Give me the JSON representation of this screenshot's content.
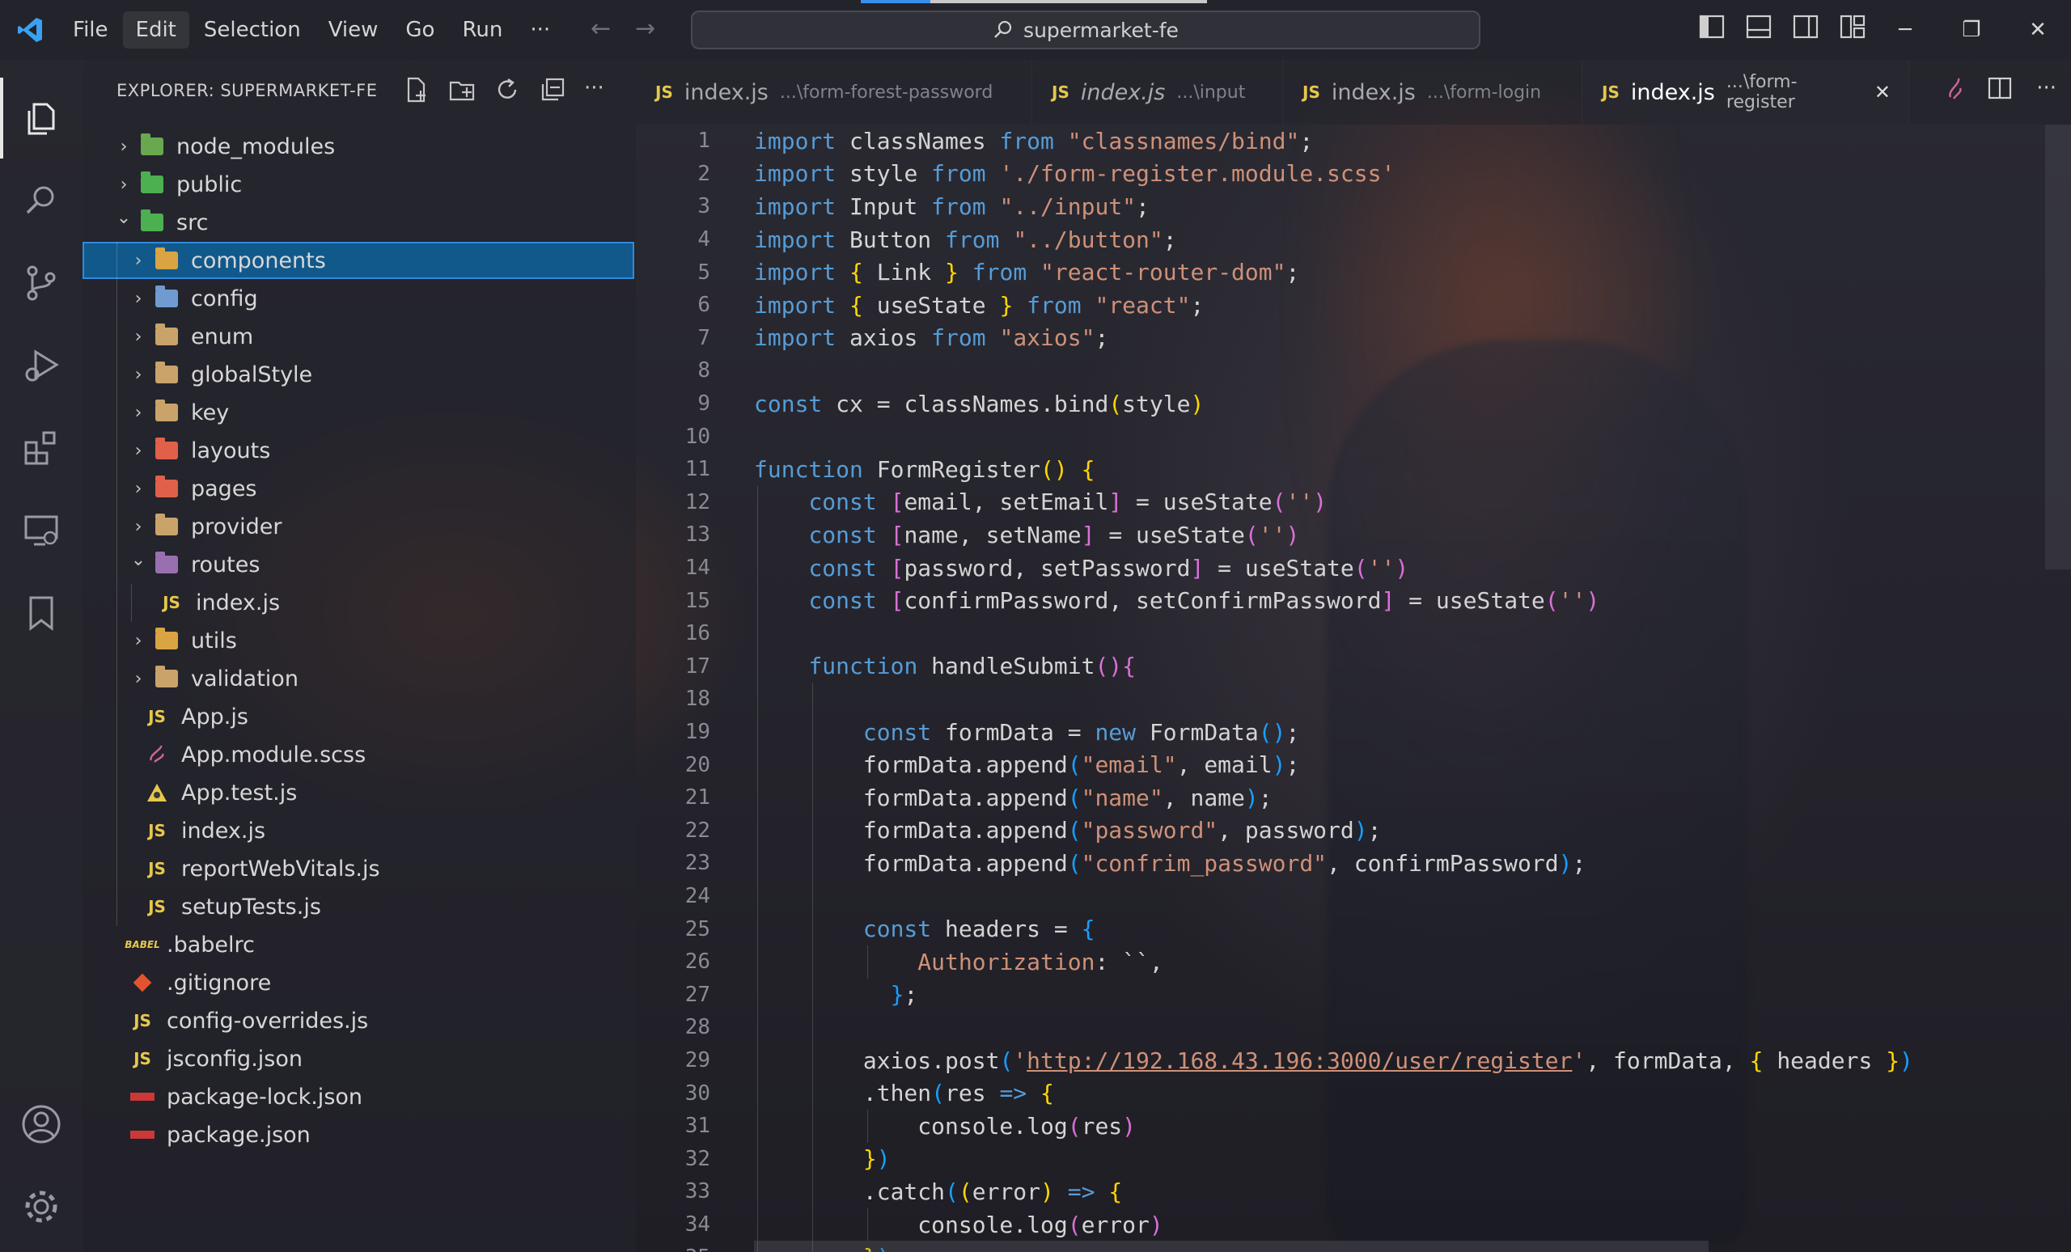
{
  "titlebar": {
    "menu": [
      "File",
      "Edit",
      "Selection",
      "View",
      "Go",
      "Run",
      "···"
    ],
    "search_text": "supermarket-fe"
  },
  "sidebar": {
    "title": "EXPLORER: SUPERMARKET-FE",
    "tree": [
      {
        "label": "node_modules",
        "type": "folder",
        "depth": 0,
        "expanded": false,
        "icon_color": "#6aa84f"
      },
      {
        "label": "public",
        "type": "folder",
        "depth": 0,
        "expanded": false,
        "icon_color": "#4caf50"
      },
      {
        "label": "src",
        "type": "folder",
        "depth": 0,
        "expanded": true,
        "icon_color": "#4caf50"
      },
      {
        "label": "components",
        "type": "folder",
        "depth": 1,
        "expanded": false,
        "icon_color": "#d9a441",
        "selected": true
      },
      {
        "label": "config",
        "type": "folder",
        "depth": 1,
        "expanded": false,
        "icon_color": "#6f9bd1"
      },
      {
        "label": "enum",
        "type": "folder",
        "depth": 1,
        "expanded": false,
        "icon_color": "#c9a36a"
      },
      {
        "label": "globalStyle",
        "type": "folder",
        "depth": 1,
        "expanded": false,
        "icon_color": "#c9a36a"
      },
      {
        "label": "key",
        "type": "folder",
        "depth": 1,
        "expanded": false,
        "icon_color": "#c9a36a"
      },
      {
        "label": "layouts",
        "type": "folder",
        "depth": 1,
        "expanded": false,
        "icon_color": "#e0604a"
      },
      {
        "label": "pages",
        "type": "folder",
        "depth": 1,
        "expanded": false,
        "icon_color": "#e0604a"
      },
      {
        "label": "provider",
        "type": "folder",
        "depth": 1,
        "expanded": false,
        "icon_color": "#c9a36a"
      },
      {
        "label": "routes",
        "type": "folder",
        "depth": 1,
        "expanded": true,
        "icon_color": "#9a6fb0"
      },
      {
        "label": "index.js",
        "type": "js",
        "depth": 2
      },
      {
        "label": "utils",
        "type": "folder",
        "depth": 1,
        "expanded": false,
        "icon_color": "#d9a441"
      },
      {
        "label": "validation",
        "type": "folder",
        "depth": 1,
        "expanded": false,
        "icon_color": "#c9a36a"
      },
      {
        "label": "App.js",
        "type": "js",
        "depth": 1
      },
      {
        "label": "App.module.scss",
        "type": "scss",
        "depth": 1
      },
      {
        "label": "App.test.js",
        "type": "test",
        "depth": 1
      },
      {
        "label": "index.js",
        "type": "js",
        "depth": 1
      },
      {
        "label": "reportWebVitals.js",
        "type": "js",
        "depth": 1
      },
      {
        "label": "setupTests.js",
        "type": "js",
        "depth": 1
      },
      {
        "label": ".babelrc",
        "type": "babel",
        "depth": 0
      },
      {
        "label": ".gitignore",
        "type": "git",
        "depth": 0
      },
      {
        "label": "config-overrides.js",
        "type": "js",
        "depth": 0
      },
      {
        "label": "jsconfig.json",
        "type": "jsconfig",
        "depth": 0
      },
      {
        "label": "package-lock.json",
        "type": "npm",
        "depth": 0
      },
      {
        "label": "package.json",
        "type": "npm",
        "depth": 0
      }
    ]
  },
  "tabs": [
    {
      "name": "index.js",
      "path": "...\\form-forest-password",
      "badge": "JS",
      "italic": false,
      "active": false
    },
    {
      "name": "index.js",
      "path": "...\\input",
      "badge": "JS",
      "italic": true,
      "active": false
    },
    {
      "name": "index.js",
      "path": "...\\form-login",
      "badge": "JS",
      "italic": false,
      "active": false
    },
    {
      "name": "index.js",
      "path": "...\\form-register",
      "badge": "JS",
      "italic": false,
      "active": true
    }
  ],
  "editor": {
    "lines": [
      [
        [
          "kw",
          "import"
        ],
        [
          "pl",
          " classNames "
        ],
        [
          "kw",
          "from"
        ],
        [
          "pl",
          " "
        ],
        [
          "str",
          "\"classnames/bind\""
        ],
        [
          "pl",
          ";"
        ]
      ],
      [
        [
          "kw",
          "import"
        ],
        [
          "pl",
          " style "
        ],
        [
          "kw",
          "from"
        ],
        [
          "pl",
          " "
        ],
        [
          "str",
          "'./form-register.module.scss'"
        ]
      ],
      [
        [
          "kw",
          "import"
        ],
        [
          "pl",
          " Input "
        ],
        [
          "kw",
          "from"
        ],
        [
          "pl",
          " "
        ],
        [
          "str",
          "\"../input\""
        ],
        [
          "pl",
          ";"
        ]
      ],
      [
        [
          "kw",
          "import"
        ],
        [
          "pl",
          " Button "
        ],
        [
          "kw",
          "from"
        ],
        [
          "pl",
          " "
        ],
        [
          "str",
          "\"../button\""
        ],
        [
          "pl",
          ";"
        ]
      ],
      [
        [
          "kw",
          "import"
        ],
        [
          "pl",
          " "
        ],
        [
          "b1",
          "{"
        ],
        [
          "pl",
          " Link "
        ],
        [
          "b1",
          "}"
        ],
        [
          "pl",
          " "
        ],
        [
          "kw",
          "from"
        ],
        [
          "pl",
          " "
        ],
        [
          "str",
          "\"react-router-dom\""
        ],
        [
          "pl",
          ";"
        ]
      ],
      [
        [
          "kw",
          "import"
        ],
        [
          "pl",
          " "
        ],
        [
          "b1",
          "{"
        ],
        [
          "pl",
          " useState "
        ],
        [
          "b1",
          "}"
        ],
        [
          "pl",
          " "
        ],
        [
          "kw",
          "from"
        ],
        [
          "pl",
          " "
        ],
        [
          "str",
          "\"react\""
        ],
        [
          "pl",
          ";"
        ]
      ],
      [
        [
          "kw",
          "import"
        ],
        [
          "pl",
          " axios "
        ],
        [
          "kw",
          "from"
        ],
        [
          "pl",
          " "
        ],
        [
          "str",
          "\"axios\""
        ],
        [
          "pl",
          ";"
        ]
      ],
      [],
      [
        [
          "kw",
          "const"
        ],
        [
          "pl",
          " cx = classNames.bind"
        ],
        [
          "b1",
          "("
        ],
        [
          "pl",
          "style"
        ],
        [
          "b1",
          ")"
        ]
      ],
      [],
      [
        [
          "kw",
          "function"
        ],
        [
          "pl",
          " FormRegister"
        ],
        [
          "b1",
          "()"
        ],
        [
          "pl",
          " "
        ],
        [
          "b1",
          "{"
        ]
      ],
      [
        [
          "pl",
          "    "
        ],
        [
          "kw",
          "const"
        ],
        [
          "pl",
          " "
        ],
        [
          "b2",
          "["
        ],
        [
          "pl",
          "email, setEmail"
        ],
        [
          "b2",
          "]"
        ],
        [
          "pl",
          " = useState"
        ],
        [
          "b2",
          "("
        ],
        [
          "str",
          "''"
        ],
        [
          "b2",
          ")"
        ]
      ],
      [
        [
          "pl",
          "    "
        ],
        [
          "kw",
          "const"
        ],
        [
          "pl",
          " "
        ],
        [
          "b2",
          "["
        ],
        [
          "pl",
          "name, setName"
        ],
        [
          "b2",
          "]"
        ],
        [
          "pl",
          " = useState"
        ],
        [
          "b2",
          "("
        ],
        [
          "str",
          "''"
        ],
        [
          "b2",
          ")"
        ]
      ],
      [
        [
          "pl",
          "    "
        ],
        [
          "kw",
          "const"
        ],
        [
          "pl",
          " "
        ],
        [
          "b2",
          "["
        ],
        [
          "pl",
          "password, setPassword"
        ],
        [
          "b2",
          "]"
        ],
        [
          "pl",
          " = useState"
        ],
        [
          "b2",
          "("
        ],
        [
          "str",
          "''"
        ],
        [
          "b2",
          ")"
        ]
      ],
      [
        [
          "pl",
          "    "
        ],
        [
          "kw",
          "const"
        ],
        [
          "pl",
          " "
        ],
        [
          "b2",
          "["
        ],
        [
          "pl",
          "confirmPassword, setConfirmPassword"
        ],
        [
          "b2",
          "]"
        ],
        [
          "pl",
          " = useState"
        ],
        [
          "b2",
          "("
        ],
        [
          "str",
          "''"
        ],
        [
          "b2",
          ")"
        ]
      ],
      [],
      [
        [
          "pl",
          "    "
        ],
        [
          "kw",
          "function"
        ],
        [
          "pl",
          " handleSubmit"
        ],
        [
          "b2",
          "()"
        ],
        [
          "b2",
          "{"
        ]
      ],
      [],
      [
        [
          "pl",
          "        "
        ],
        [
          "kw",
          "const"
        ],
        [
          "pl",
          " formData = "
        ],
        [
          "kw",
          "new"
        ],
        [
          "pl",
          " FormData"
        ],
        [
          "b3",
          "()"
        ],
        [
          "pl",
          ";"
        ]
      ],
      [
        [
          "pl",
          "        formData.append"
        ],
        [
          "b3",
          "("
        ],
        [
          "str",
          "\"email\""
        ],
        [
          "pl",
          ", email"
        ],
        [
          "b3",
          ")"
        ],
        [
          "pl",
          ";"
        ]
      ],
      [
        [
          "pl",
          "        formData.append"
        ],
        [
          "b3",
          "("
        ],
        [
          "str",
          "\"name\""
        ],
        [
          "pl",
          ", name"
        ],
        [
          "b3",
          ")"
        ],
        [
          "pl",
          ";"
        ]
      ],
      [
        [
          "pl",
          "        formData.append"
        ],
        [
          "b3",
          "("
        ],
        [
          "str",
          "\"password\""
        ],
        [
          "pl",
          ", password"
        ],
        [
          "b3",
          ")"
        ],
        [
          "pl",
          ";"
        ]
      ],
      [
        [
          "pl",
          "        formData.append"
        ],
        [
          "b3",
          "("
        ],
        [
          "str",
          "\"confrim_password\""
        ],
        [
          "pl",
          ", confirmPassword"
        ],
        [
          "b3",
          ")"
        ],
        [
          "pl",
          ";"
        ]
      ],
      [],
      [
        [
          "pl",
          "        "
        ],
        [
          "kw",
          "const"
        ],
        [
          "pl",
          " headers = "
        ],
        [
          "b3",
          "{"
        ]
      ],
      [
        [
          "pl",
          "            "
        ],
        [
          "str",
          "Authorization"
        ],
        [
          "pl",
          ": ``,"
        ]
      ],
      [
        [
          "pl",
          "          "
        ],
        [
          "b3",
          "}"
        ],
        [
          "pl",
          ";"
        ]
      ],
      [],
      [
        [
          "pl",
          "        axios.post"
        ],
        [
          "b3",
          "("
        ],
        [
          "str",
          "'"
        ],
        [
          "url",
          "http://192.168.43.196:3000/user/register"
        ],
        [
          "str",
          "'"
        ],
        [
          "pl",
          ", formData, "
        ],
        [
          "b1",
          "{"
        ],
        [
          "pl",
          " headers "
        ],
        [
          "b1",
          "}"
        ],
        [
          "b3",
          ")"
        ]
      ],
      [
        [
          "pl",
          "        .then"
        ],
        [
          "b3",
          "("
        ],
        [
          "pl",
          "res "
        ],
        [
          "kw",
          "=>"
        ],
        [
          "pl",
          " "
        ],
        [
          "b1",
          "{"
        ]
      ],
      [
        [
          "pl",
          "            console.log"
        ],
        [
          "b2",
          "("
        ],
        [
          "pl",
          "res"
        ],
        [
          "b2",
          ")"
        ]
      ],
      [
        [
          "pl",
          "        "
        ],
        [
          "b1",
          "}"
        ],
        [
          "b3",
          ")"
        ]
      ],
      [
        [
          "pl",
          "        .catch"
        ],
        [
          "b3",
          "("
        ],
        [
          "b1",
          "("
        ],
        [
          "pl",
          "error"
        ],
        [
          "b1",
          ")"
        ],
        [
          "pl",
          " "
        ],
        [
          "kw",
          "=>"
        ],
        [
          "pl",
          " "
        ],
        [
          "b1",
          "{"
        ]
      ],
      [
        [
          "pl",
          "            console.log"
        ],
        [
          "b2",
          "("
        ],
        [
          "pl",
          "error"
        ],
        [
          "b2",
          ")"
        ]
      ],
      [
        [
          "pl",
          "        "
        ],
        [
          "b1",
          "}"
        ],
        [
          "b3",
          ")"
        ]
      ]
    ]
  }
}
